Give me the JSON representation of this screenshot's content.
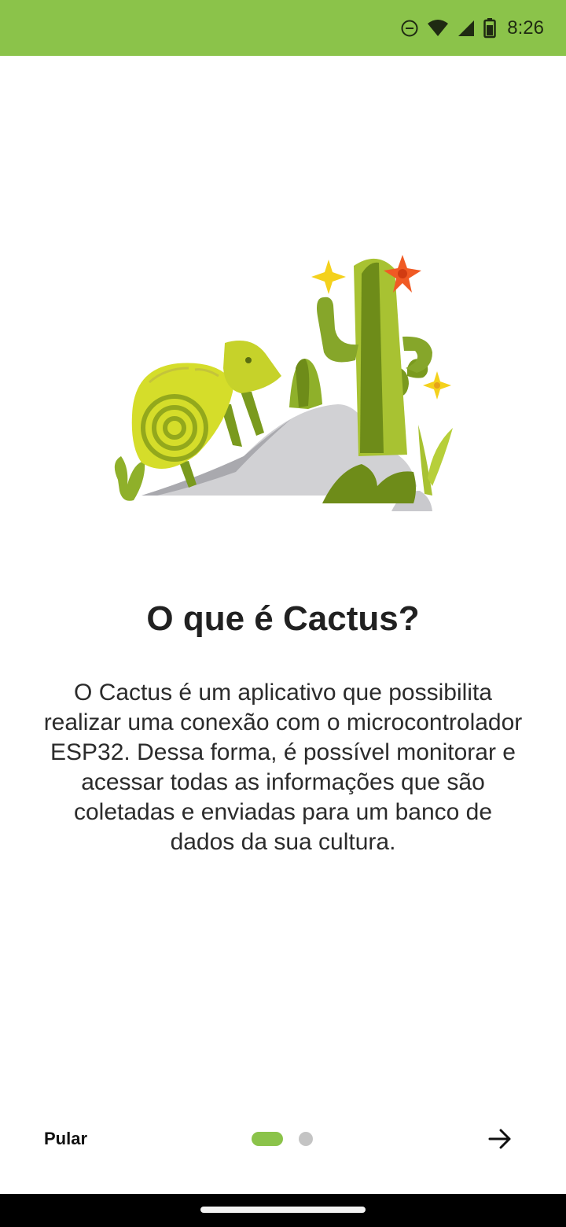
{
  "status_bar": {
    "time": "8:26",
    "background": "#8bc34a",
    "icons": [
      "do-not-disturb-icon",
      "wifi-icon",
      "signal-icon",
      "battery-icon"
    ]
  },
  "onboarding": {
    "illustration": "cactus-chameleon-illustration",
    "title": "O que é Cactus?",
    "description": "O Cactus é um aplicativo que possibilita realizar uma conexão com o microcontrolador ESP32. Dessa forma, é possível monitorar e acessar todas as informações que são coletadas e enviadas para um banco de dados da sua cultura.",
    "current_page": 1,
    "total_pages": 2
  },
  "bottom_bar": {
    "skip_label": "Pular",
    "next_icon": "arrow-right-icon",
    "accent": "#8bc34a",
    "inactive_dot": "#c4c4c4"
  }
}
